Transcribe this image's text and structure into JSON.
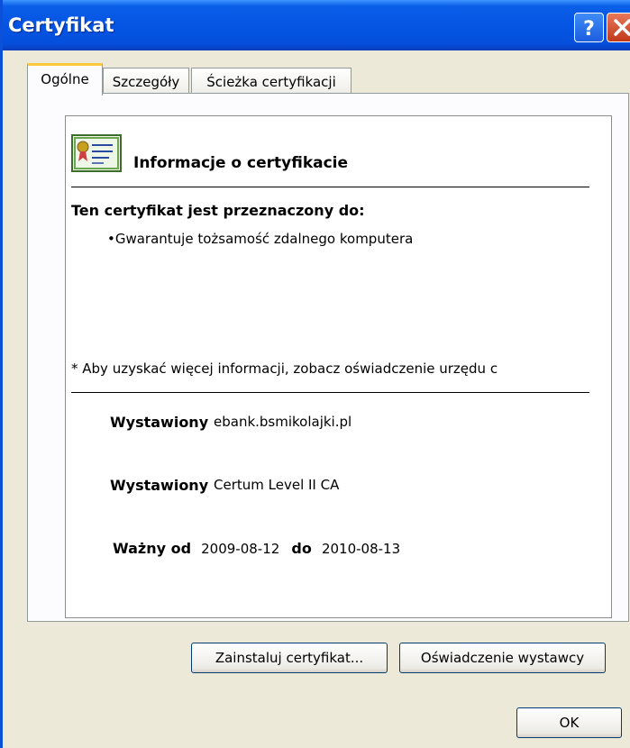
{
  "window": {
    "title": "Certyfikat",
    "help_glyph": "?",
    "close_glyph": "✕"
  },
  "tabs": [
    {
      "label": "Ogólne",
      "active": true
    },
    {
      "label": "Szczegóły",
      "active": false
    },
    {
      "label": "Ścieżka certyfikacji",
      "active": false
    }
  ],
  "general": {
    "icon": "certificate-icon",
    "info_title": "Informacje o certyfikacie",
    "purpose_heading": "Ten certyfikat jest przeznaczony do:",
    "purpose_items": [
      "•Gwarantuje tożsamość zdalnego komputera"
    ],
    "note": "* Aby uzyskać więcej informacji, zobacz oświadczenie urzędu c",
    "issued_to_label": "Wystawiony dla:",
    "issued_to_value": "ebank.bsmikolajki.pl",
    "issued_by_label": "Wystawiony przez:",
    "issued_by_value": "Certum Level II CA",
    "valid_from_label": "Ważny od",
    "valid_from_value": "2009-08-12",
    "valid_to_label": "do",
    "valid_to_value": "2010-08-13"
  },
  "buttons": {
    "install": "Zainstaluj certyfikat...",
    "statement": "Oświadczenie wystawcy",
    "ok": "OK"
  },
  "colors": {
    "titlebar": "#0554e3",
    "dialog_bg": "#ece9d8",
    "active_tab_accent": "#ffc83c"
  }
}
